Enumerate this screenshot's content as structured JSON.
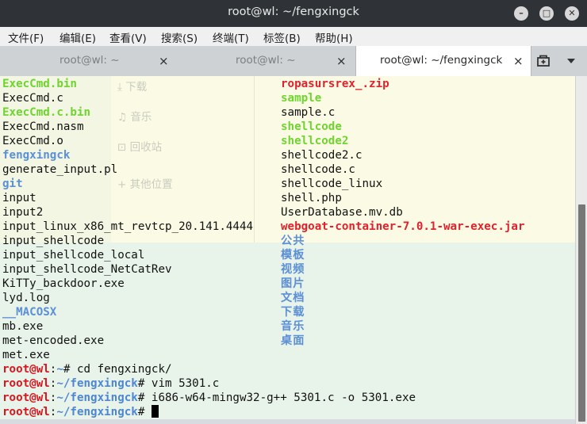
{
  "window": {
    "title": "root@wl: ~/fengxingck",
    "btn_minimize": "–",
    "btn_maximize": "□",
    "btn_close": "✕"
  },
  "menu": [
    "文件(F)",
    "编辑(E)",
    "查看(V)",
    "搜索(S)",
    "终端(T)",
    "标签(B)",
    "帮助(H)"
  ],
  "tabs": [
    {
      "label": "root@wl: ~",
      "close": "×"
    },
    {
      "label": "root@wl: ~",
      "close": "×"
    },
    {
      "label": "root@wl: ~/fengxingck",
      "close": "×"
    }
  ],
  "tabbar_icons": {
    "new_tab": "new-tab-icon",
    "menu": "dropdown-icon"
  },
  "ghost_sidebar": [
    "下载",
    "音乐",
    "回收站",
    "其他位置"
  ],
  "ls_col1": [
    {
      "text": "ExecCmd.bin",
      "style": "green"
    },
    {
      "text": "ExecCmd.c",
      "style": "plain"
    },
    {
      "text": "ExecCmd.c.bin",
      "style": "green"
    },
    {
      "text": "ExecCmd.nasm",
      "style": "plain"
    },
    {
      "text": "ExecCmd.o",
      "style": "plain"
    },
    {
      "text": "fengxingck",
      "style": "blue"
    },
    {
      "text": "generate_input.pl",
      "style": "plain"
    },
    {
      "text": "git",
      "style": "blue"
    },
    {
      "text": "input",
      "style": "plain"
    },
    {
      "text": "input2",
      "style": "plain"
    },
    {
      "text": "input_linux_x86_mt_revtcp_20.141.4444",
      "style": "plain"
    },
    {
      "text": "input_shellcode",
      "style": "plain"
    },
    {
      "text": "input_shellcode_local",
      "style": "plain"
    },
    {
      "text": "input_shellcode_NetCatRev",
      "style": "plain"
    },
    {
      "text": "KiTTy_backdoor.exe",
      "style": "plain"
    },
    {
      "text": "lyd.log",
      "style": "plain"
    },
    {
      "text": "__MACOSX",
      "style": "blue"
    },
    {
      "text": "mb.exe",
      "style": "plain"
    },
    {
      "text": "met-encoded.exe",
      "style": "plain"
    },
    {
      "text": "met.exe",
      "style": "plain"
    }
  ],
  "ls_col2": [
    {
      "text": "ropasursrex_.zip",
      "style": "red"
    },
    {
      "text": "sample",
      "style": "green"
    },
    {
      "text": "sample.c",
      "style": "plain"
    },
    {
      "text": "shellcode",
      "style": "green"
    },
    {
      "text": "shellcode2",
      "style": "green"
    },
    {
      "text": "shellcode2.c",
      "style": "plain"
    },
    {
      "text": "shellcode.c",
      "style": "plain"
    },
    {
      "text": "shellcode_linux",
      "style": "plain"
    },
    {
      "text": "shell.php",
      "style": "plain"
    },
    {
      "text": "UserDatabase.mv.db",
      "style": "plain"
    },
    {
      "text": "webgoat-container-7.0.1-war-exec.jar",
      "style": "red"
    },
    {
      "text": "公共",
      "style": "blue"
    },
    {
      "text": "模板",
      "style": "blue"
    },
    {
      "text": "视频",
      "style": "blue"
    },
    {
      "text": "图片",
      "style": "blue"
    },
    {
      "text": "文档",
      "style": "blue"
    },
    {
      "text": "下载",
      "style": "blue"
    },
    {
      "text": "音乐",
      "style": "blue"
    },
    {
      "text": "桌面",
      "style": "blue"
    }
  ],
  "prompts": [
    {
      "user": "root@wl",
      "sep": ":",
      "path": "~",
      "sym": "#",
      "cmd": " cd fengxingck/"
    },
    {
      "user": "root@wl",
      "sep": ":",
      "path": "~/fengxingck",
      "sym": "#",
      "cmd": " vim 5301.c"
    },
    {
      "user": "root@wl",
      "sep": ":",
      "path": "~/fengxingck",
      "sym": "#",
      "cmd": " i686-w64-mingw32-g++ 5301.c -o 5301.exe"
    },
    {
      "user": "root@wl",
      "sep": ":",
      "path": "~/fengxingck",
      "sym": "#",
      "cmd": " "
    }
  ],
  "colors": {
    "green": "#6fd42f",
    "blue": "#5b8fd6",
    "red": "#e0222c",
    "prompt_user": "#d9151d",
    "prompt_path": "#4f86d3"
  }
}
